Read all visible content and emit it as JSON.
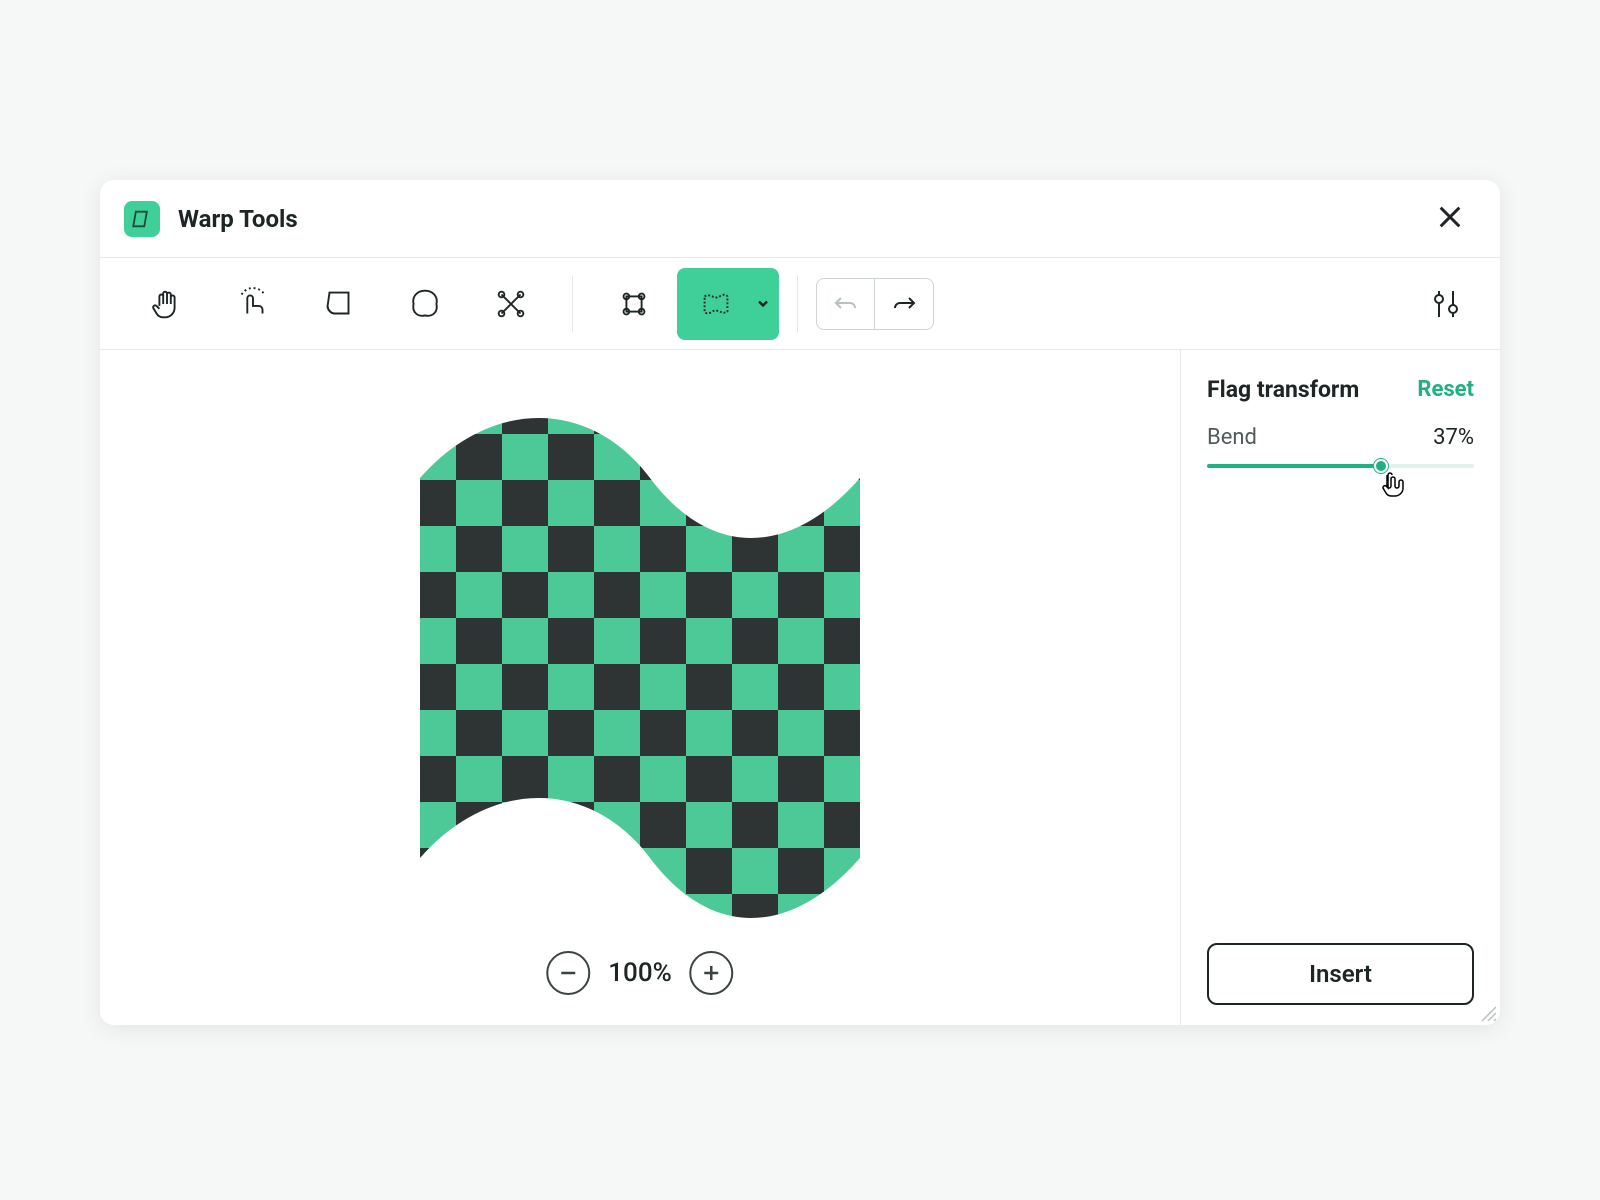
{
  "header": {
    "title": "Warp Tools"
  },
  "toolbar": {
    "tools": {
      "pan": "pan-tool",
      "warp": "warp-tool",
      "fold": "fold-tool",
      "blob": "blob-tool",
      "crop": "crop-tool",
      "mesh": "mesh-tool",
      "flag": "flag-tool"
    },
    "active_tool": "flag-tool"
  },
  "canvas": {
    "zoom": "100%"
  },
  "sidebar": {
    "section_title": "Flag transform",
    "reset_label": "Reset",
    "slider": {
      "label": "Bend",
      "value_display": "37%",
      "percent": 65
    },
    "insert_label": "Insert"
  },
  "colors": {
    "accent": "#3fcf99",
    "accent_dark": "#1fb27f",
    "checker_dark": "#2e3333",
    "checker_light": "#4dc998"
  }
}
